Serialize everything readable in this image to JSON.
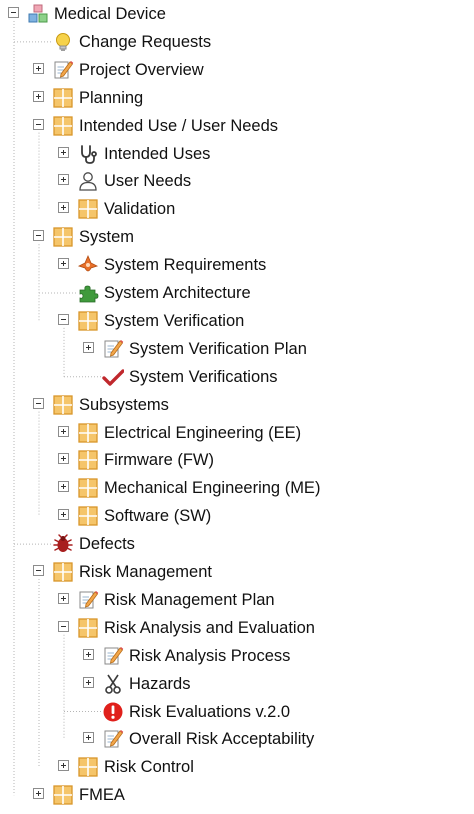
{
  "tree": {
    "nodes": [
      {
        "label": "Medical Device",
        "depth": 0,
        "expander": "minus",
        "icon": "colored-blocks-icon"
      },
      {
        "label": "Change Requests",
        "depth": 1,
        "expander": "none",
        "icon": "lightbulb-icon"
      },
      {
        "label": "Project Overview",
        "depth": 1,
        "expander": "plus",
        "icon": "document-pencil-icon"
      },
      {
        "label": "Planning",
        "depth": 1,
        "expander": "plus",
        "icon": "folder-grid-icon"
      },
      {
        "label": "Intended Use / User Needs",
        "depth": 1,
        "expander": "minus",
        "icon": "folder-grid-icon"
      },
      {
        "label": "Intended Uses",
        "depth": 2,
        "expander": "plus",
        "icon": "stethoscope-icon"
      },
      {
        "label": "User Needs",
        "depth": 2,
        "expander": "plus",
        "icon": "user-icon"
      },
      {
        "label": "Validation",
        "depth": 2,
        "expander": "plus",
        "icon": "folder-grid-icon"
      },
      {
        "label": "System",
        "depth": 1,
        "expander": "minus",
        "icon": "folder-grid-icon"
      },
      {
        "label": "System Requirements",
        "depth": 2,
        "expander": "plus",
        "icon": "requirements-icon"
      },
      {
        "label": "System Architecture",
        "depth": 2,
        "expander": "none",
        "icon": "puzzle-icon"
      },
      {
        "label": "System Verification",
        "depth": 2,
        "expander": "minus",
        "icon": "folder-grid-icon"
      },
      {
        "label": "System Verification Plan",
        "depth": 3,
        "expander": "plus",
        "icon": "document-pencil-icon"
      },
      {
        "label": "System Verifications",
        "depth": 3,
        "expander": "none",
        "icon": "checkmark-icon"
      },
      {
        "label": "Subsystems",
        "depth": 1,
        "expander": "minus",
        "icon": "folder-grid-icon"
      },
      {
        "label": "Electrical Engineering (EE)",
        "depth": 2,
        "expander": "plus",
        "icon": "folder-grid-icon"
      },
      {
        "label": "Firmware (FW)",
        "depth": 2,
        "expander": "plus",
        "icon": "folder-grid-icon"
      },
      {
        "label": "Mechanical Engineering (ME)",
        "depth": 2,
        "expander": "plus",
        "icon": "folder-grid-icon"
      },
      {
        "label": "Software (SW)",
        "depth": 2,
        "expander": "plus",
        "icon": "folder-grid-icon"
      },
      {
        "label": "Defects",
        "depth": 1,
        "expander": "none",
        "icon": "bug-icon"
      },
      {
        "label": "Risk Management",
        "depth": 1,
        "expander": "minus",
        "icon": "folder-grid-icon"
      },
      {
        "label": "Risk Management Plan",
        "depth": 2,
        "expander": "plus",
        "icon": "document-pencil-icon"
      },
      {
        "label": "Risk Analysis and Evaluation",
        "depth": 2,
        "expander": "minus",
        "icon": "folder-grid-icon"
      },
      {
        "label": "Risk Analysis Process",
        "depth": 3,
        "expander": "plus",
        "icon": "document-pencil-icon"
      },
      {
        "label": "Hazards",
        "depth": 3,
        "expander": "plus",
        "icon": "scissors-icon"
      },
      {
        "label": "Risk Evaluations v.2.0",
        "depth": 3,
        "expander": "none",
        "icon": "warning-icon"
      },
      {
        "label": "Overall Risk Acceptability",
        "depth": 3,
        "expander": "plus",
        "icon": "document-pencil-icon"
      },
      {
        "label": "Risk Control",
        "depth": 2,
        "expander": "plus",
        "icon": "folder-grid-icon"
      },
      {
        "label": "FMEA",
        "depth": 1,
        "expander": "plus",
        "icon": "folder-grid-icon"
      }
    ]
  },
  "colors": {
    "folder_fill": "#f5c56a",
    "folder_border": "#d8962a",
    "tree_line": "#b5b5b5",
    "checkmark": "#c0282d",
    "warning": "#e0201b",
    "bug": "#a81e1e",
    "puzzle": "#3f9a3c",
    "requirements": "#e8702a"
  }
}
